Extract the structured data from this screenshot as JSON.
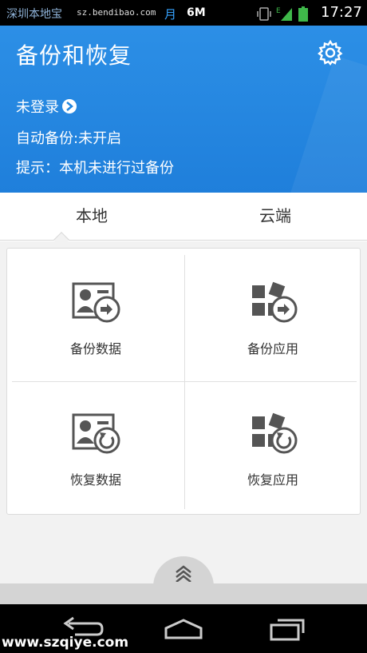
{
  "status_bar": {
    "watermark": "深圳本地宝",
    "url": "sz.bendibao.com",
    "moon": "月",
    "memory": "6M",
    "time": "17:27"
  },
  "header": {
    "title": "备份和恢复",
    "login": "未登录",
    "auto_backup": "自动备份:未开启",
    "tip": "提示：本机未进行过备份"
  },
  "tabs": [
    {
      "label": "本地",
      "active": true
    },
    {
      "label": "云端",
      "active": false
    }
  ],
  "actions": [
    {
      "label": "备份数据",
      "icon": "contact-card-arrow-icon"
    },
    {
      "label": "备份应用",
      "icon": "apps-arrow-icon"
    },
    {
      "label": "恢复数据",
      "icon": "contact-card-restore-icon"
    },
    {
      "label": "恢复应用",
      "icon": "apps-restore-icon"
    }
  ],
  "footer_watermark": "www.szqiye.com",
  "colors": {
    "header_bg": "#2286e0",
    "icon_gray": "#555555",
    "page_bg": "#f2f2f2"
  }
}
